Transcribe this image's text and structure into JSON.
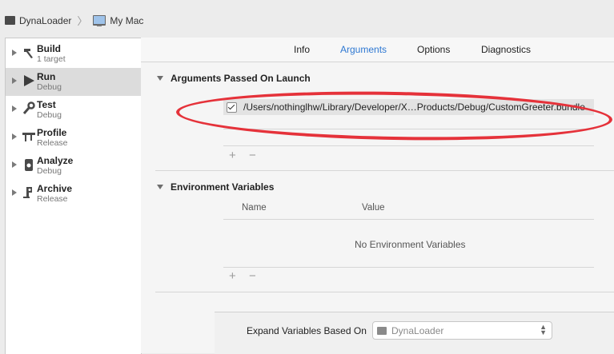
{
  "breadcrumb": {
    "scheme": "DynaLoader",
    "destination": "My Mac"
  },
  "sidebar": {
    "items": [
      {
        "title": "Build",
        "subtitle": "1 target",
        "icon": "hammer-icon",
        "selected": false
      },
      {
        "title": "Run",
        "subtitle": "Debug",
        "icon": "play-icon",
        "selected": true
      },
      {
        "title": "Test",
        "subtitle": "Debug",
        "icon": "wrench-icon",
        "selected": false
      },
      {
        "title": "Profile",
        "subtitle": "Release",
        "icon": "caliper-icon",
        "selected": false
      },
      {
        "title": "Analyze",
        "subtitle": "Debug",
        "icon": "analyze-icon",
        "selected": false
      },
      {
        "title": "Archive",
        "subtitle": "Release",
        "icon": "archive-icon",
        "selected": false
      }
    ]
  },
  "tabs": [
    {
      "label": "Info",
      "active": false
    },
    {
      "label": "Arguments",
      "active": true
    },
    {
      "label": "Options",
      "active": false
    },
    {
      "label": "Diagnostics",
      "active": false
    }
  ],
  "arguments": {
    "section_title": "Arguments Passed On Launch",
    "items": [
      {
        "checked": true,
        "value": "/Users/nothinglhw/Library/Developer/X…Products/Debug/CustomGreeter.bundle"
      }
    ],
    "add_label": "+",
    "remove_label": "−"
  },
  "environment": {
    "section_title": "Environment Variables",
    "columns": [
      "Name",
      "Value"
    ],
    "empty_message": "No Environment Variables",
    "add_label": "+",
    "remove_label": "−"
  },
  "expand_variables": {
    "label": "Expand Variables Based On",
    "value": "DynaLoader"
  },
  "colors": {
    "accent": "#2e78d2",
    "annotation": "#e5323a"
  }
}
